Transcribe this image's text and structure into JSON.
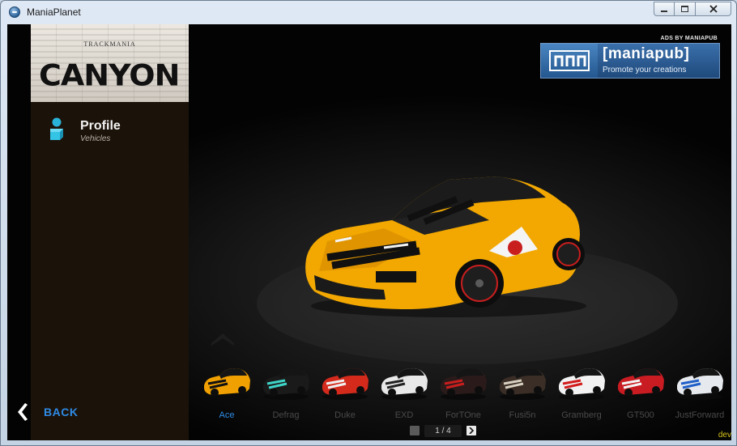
{
  "window": {
    "title": "ManiaPlanet"
  },
  "sidebar": {
    "logo_small": "TRACKMANIA",
    "logo_big": "CANYON",
    "profile_title": "Profile",
    "profile_subtitle": "Vehicles",
    "back_label": "BACK"
  },
  "ad": {
    "caption": "ADS BY MANIAPUB",
    "brand": "[maniapub]",
    "tagline": "Promote your creations"
  },
  "carousel": {
    "selected": "Ace",
    "vehicles": [
      {
        "name": "Ace",
        "body_color": "#f0a000",
        "stripe_color": "#111111"
      },
      {
        "name": "Defrag",
        "body_color": "#1a1a1a",
        "stripe_color": "#3fd4c8"
      },
      {
        "name": "Duke",
        "body_color": "#d42a1c",
        "stripe_color": "#f0f0f0"
      },
      {
        "name": "EXD",
        "body_color": "#e8e8e8",
        "stripe_color": "#222222"
      },
      {
        "name": "ForTOne",
        "body_color": "#2a1a1a",
        "stripe_color": "#c81e1e"
      },
      {
        "name": "Fusi5n",
        "body_color": "#3a2e26",
        "stripe_color": "#d8d0c0"
      },
      {
        "name": "Gramberg",
        "body_color": "#f2f2f2",
        "stripe_color": "#d21c1c"
      },
      {
        "name": "GT500",
        "body_color": "#c81c22",
        "stripe_color": "#f4f4f4"
      },
      {
        "name": "JustForward",
        "body_color": "#e6e9ee",
        "stripe_color": "#2060c8"
      }
    ],
    "page": "1 / 4"
  },
  "footer": {
    "dev_tag": "dev"
  },
  "colors": {
    "accent_blue": "#2e8be6",
    "panel_brown": "#1b1209",
    "car_yellow": "#f2a800"
  }
}
